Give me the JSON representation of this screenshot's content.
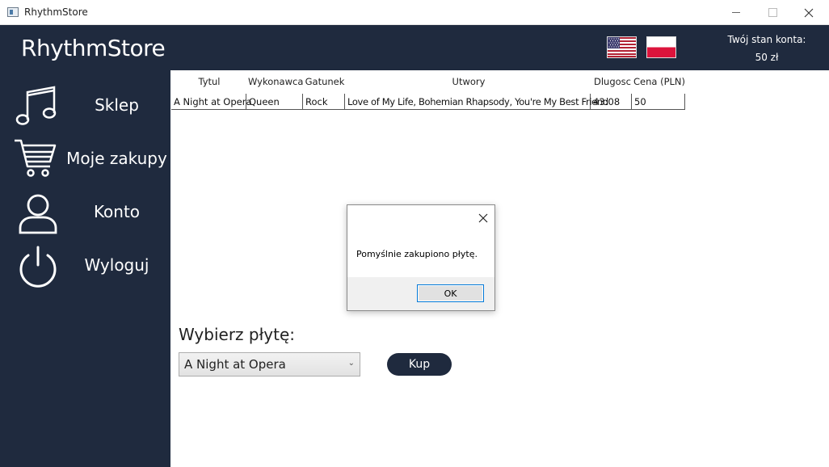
{
  "window": {
    "title": "RhythmStore"
  },
  "header": {
    "brand": "RhythmStore",
    "balance_label": "Twój stan konta:",
    "balance_value": "50 zł",
    "flags": [
      "flag-us",
      "flag-pl"
    ]
  },
  "sidebar": {
    "items": [
      {
        "label": "Sklep",
        "icon": "music-note-icon"
      },
      {
        "label": "Moje zakupy",
        "icon": "cart-icon"
      },
      {
        "label": "Konto",
        "icon": "user-icon"
      },
      {
        "label": "Wyloguj",
        "icon": "power-icon"
      }
    ]
  },
  "table": {
    "headers": [
      "Tytul",
      "Wykonawca",
      "Gatunek",
      "Utwory",
      "Dlugosc",
      "Cena (PLN)"
    ],
    "rows": [
      [
        "A Night at Opera",
        "Queen",
        "Rock",
        "Love of My Life, Bohemian Rhapsody, You're My Best Friend",
        "43:08",
        "50"
      ]
    ]
  },
  "purchase": {
    "label": "Wybierz płytę:",
    "selected": "A Night at Opera",
    "buy_label": "Kup"
  },
  "dialog": {
    "message": "Pomyślnie zakupiono płytę.",
    "ok_label": "OK"
  },
  "colors": {
    "navy": "#1f2a3e"
  }
}
